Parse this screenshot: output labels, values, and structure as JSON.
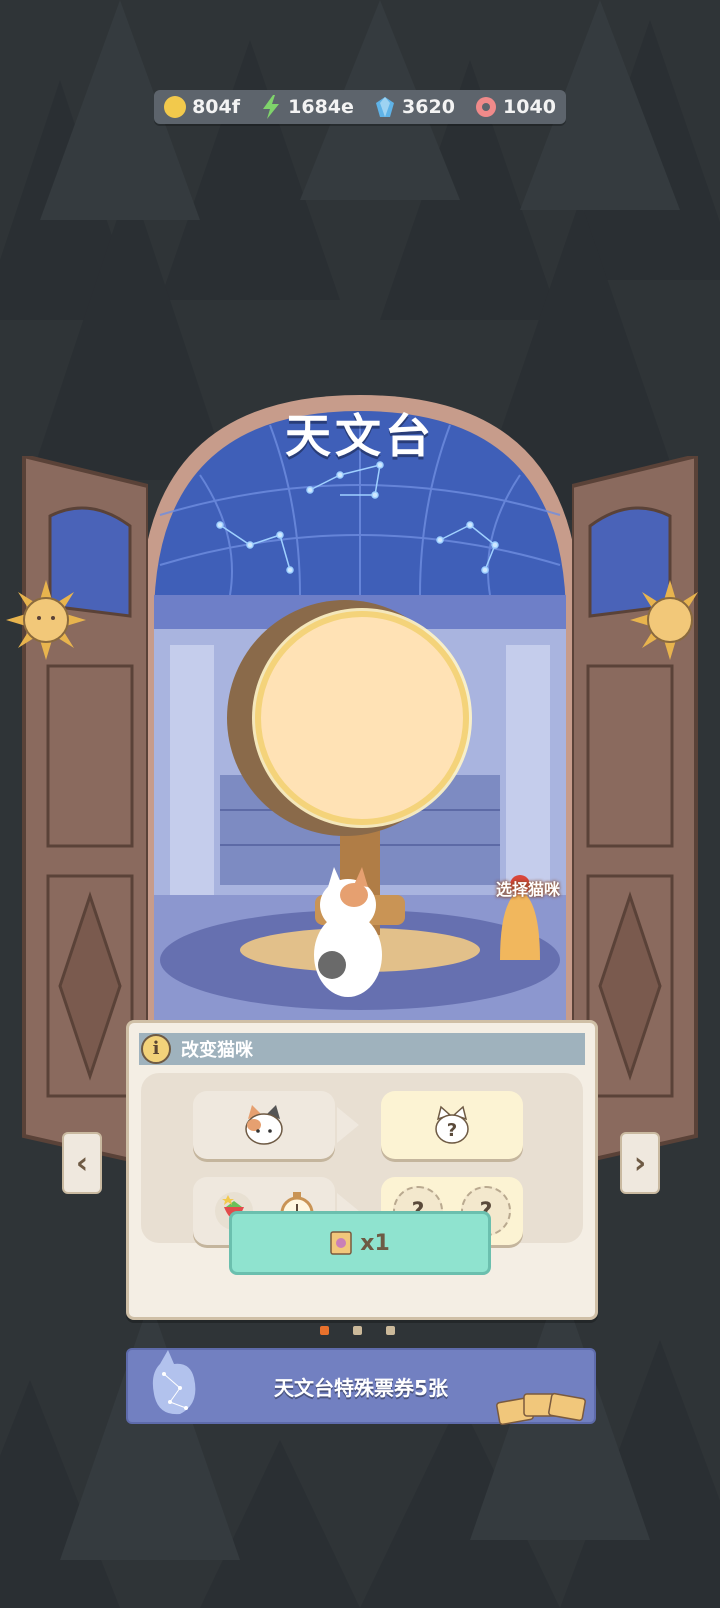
{
  "resources": [
    {
      "icon": "gold-coin-icon",
      "value": "804f",
      "color": "#f2c94c"
    },
    {
      "icon": "lightning-energy-icon",
      "value": "1684e",
      "color": "#7fd36b"
    },
    {
      "icon": "blue-gem-icon",
      "value": "3620",
      "color": "#5fb3e8"
    },
    {
      "icon": "donut-icon",
      "value": "1040",
      "color": "#f08a8a"
    }
  ],
  "title": "天文台",
  "select_cat_label": "选择猫咪",
  "panel": {
    "header_label": "改变猫咪",
    "info_icon": "i",
    "row1": {
      "left_icon": "calico-cat-face-icon",
      "right_icon": "unknown-cat-icon",
      "right_symbol": "?"
    },
    "row2": {
      "left_icons": [
        "strawberry-icon",
        "stopwatch-icon"
      ],
      "right_symbols": [
        "?",
        "?"
      ]
    },
    "confirm_label": "x1",
    "confirm_icon": "ticket-icon"
  },
  "nav": {
    "prev": "‹",
    "next": "›"
  },
  "pagination": {
    "colors": [
      "#e8712c",
      "#cbb99a",
      "#cbb99a"
    ]
  },
  "banner": {
    "label": "天文台特殊票券5张"
  },
  "colors": {
    "sky": "#3f5fb8",
    "door": "#8a6a5e",
    "globe": "#ffe2b5"
  }
}
